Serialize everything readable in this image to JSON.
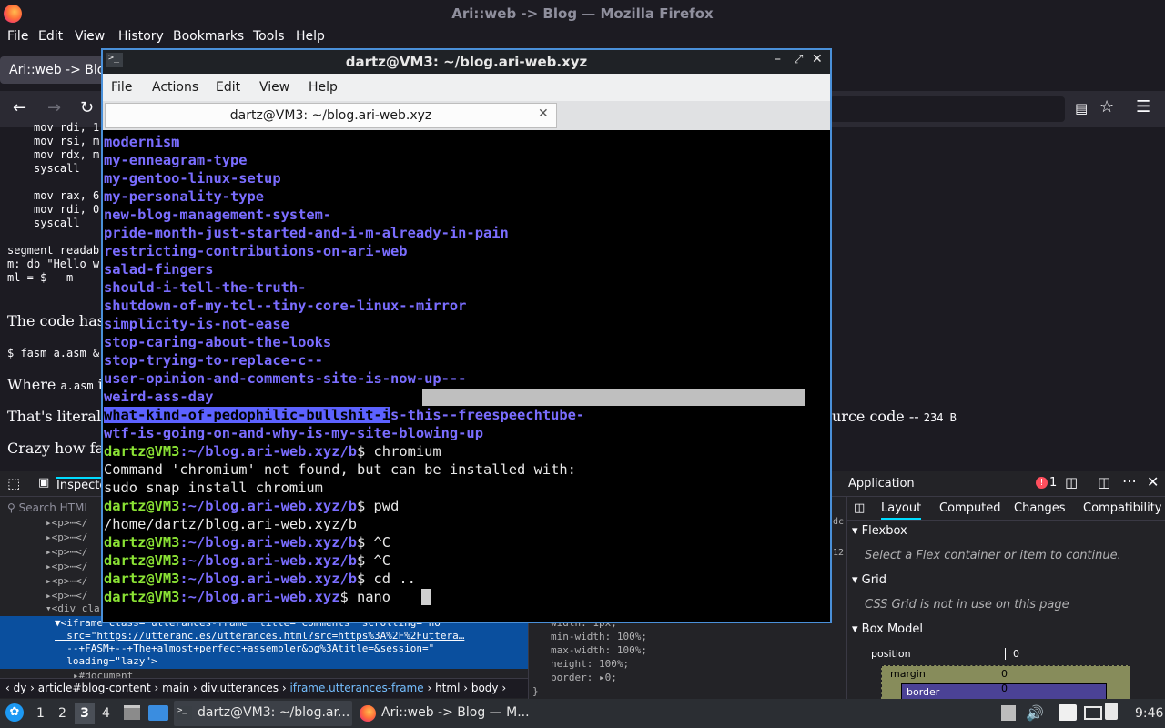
{
  "firefox": {
    "window_title": "Ari::web -> Blog — Mozilla Firefox",
    "menu": [
      "File",
      "Edit",
      "View",
      "History",
      "Bookmarks",
      "Tools",
      "Help"
    ],
    "tab_title": "Ari::web -> Blog",
    "page": {
      "code_lines": [
        "mov rdi, 1",
        "mov rsi, m",
        "mov rdx, m",
        "syscall",
        "",
        "mov rax, 6",
        "mov rdi, 0",
        "syscall",
        "",
        "segment readab",
        "m: db \"Hello w",
        "ml = $ - m"
      ],
      "para1": "The code has",
      "cmd": "$ fasm a.asm &",
      "para2_a": "Where ",
      "para2_code": "a.asm",
      "para2_b": " i",
      "para3": "That's literal",
      "para3_right": "urce code -- ",
      "para3_size": "234 B",
      "para4": "Crazy how fa"
    },
    "devtools": {
      "inspector_tab": "Inspecto",
      "search_placeholder": "Search HTML",
      "tree_lines": [
        "<p>⋯</",
        "<p>⋯</",
        "<p>⋯</",
        "<p>⋯</",
        "<p>⋯</",
        "<p>⋯</",
        "<div cla"
      ],
      "selected_lines": [
        "▼<iframe class=\"utterances-frame\" title=\"Comments\" scrolling=\"no\"",
        "  src=\"https://utteranc.es/utterances.html?src=https%3A%2F%2Futtera…",
        "  --+FASM+--+The+almost+perfect+assembler&og%3Atitle=&session=\"",
        "  loading=\"lazy\">"
      ],
      "document_line": "#document",
      "breadcrumbs": [
        "dy",
        "article#blog-content",
        "main",
        "div.utterances",
        "iframe.utterances-frame",
        "html",
        "body"
      ],
      "rules": [
        "width: 1px;",
        "min-width: 100%;",
        "max-width: 100%;",
        "height: 100%;",
        "border: ▸0;",
        "}"
      ],
      "rules_side": [
        "dc",
        "12"
      ],
      "application_tab": "Application",
      "error_count": "1",
      "side_tabs": [
        "Layout",
        "Computed",
        "Changes",
        "Compatibility"
      ],
      "flexbox_title": "Flexbox",
      "flexbox_note": "Select a Flex container or item to continue.",
      "grid_title": "Grid",
      "grid_note": "CSS Grid is not in use on this page",
      "boxmodel_title": "Box Model",
      "position_label": "position",
      "position_value": "0",
      "margin_label": "margin",
      "margin_value": "0",
      "border_label": "border",
      "border_value": "0"
    }
  },
  "terminal": {
    "window_title": "dartz@VM3: ~/blog.ari-web.xyz",
    "menu": [
      "File",
      "Actions",
      "Edit",
      "View",
      "Help"
    ],
    "tab_title": "dartz@VM3: ~/blog.ari-web.xyz",
    "dir_list": [
      "modernism",
      "my-enneagram-type",
      "my-gentoo-linux-setup",
      "my-personality-type",
      "new-blog-management-system-",
      "pride-month-just-started-and-i-m-already-in-pain",
      "restricting-contributions-on-ari-web",
      "salad-fingers",
      "should-i-tell-the-truth-",
      "shutdown-of-my-tcl--tiny-core-linux--mirror",
      "simplicity-is-not-ease",
      "stop-caring-about-the-looks",
      "stop-trying-to-replace-c--",
      "user-opinion-and-comments-site-is-now-up---",
      "weird-ass-day"
    ],
    "selected_dir_a": "what-kind-of-pedophilic-bullshit-i",
    "selected_dir_b": "s-this--freespeechtube-",
    "last_dir": "wtf-is-going-on-and-why-is-my-site-blowing-up",
    "prompt_user": "dartz@VM3",
    "sessions": [
      {
        "path": ":~/blog.ari-web.xyz/b",
        "cmd": "$ chromium"
      },
      {
        "out": "Command 'chromium' not found, but can be installed with:"
      },
      {
        "out": "sudo snap install chromium"
      },
      {
        "path": ":~/blog.ari-web.xyz/b",
        "cmd": "$ pwd"
      },
      {
        "out": "/home/dartz/blog.ari-web.xyz/b"
      },
      {
        "path": ":~/blog.ari-web.xyz/b",
        "cmd": "$ ^C"
      },
      {
        "path": ":~/blog.ari-web.xyz/b",
        "cmd": "$ ^C"
      },
      {
        "path": ":~/blog.ari-web.xyz/b",
        "cmd": "$ cd .."
      },
      {
        "path": ":~/blog.ari-web.xyz",
        "cmd": "$ nano "
      }
    ]
  },
  "taskbar": {
    "workspaces": [
      "1",
      "2",
      "3",
      "4"
    ],
    "tasks": [
      "dartz@VM3: ~/blog.ar...",
      "Ari::web -> Blog — M..."
    ],
    "clock": "9:46"
  }
}
